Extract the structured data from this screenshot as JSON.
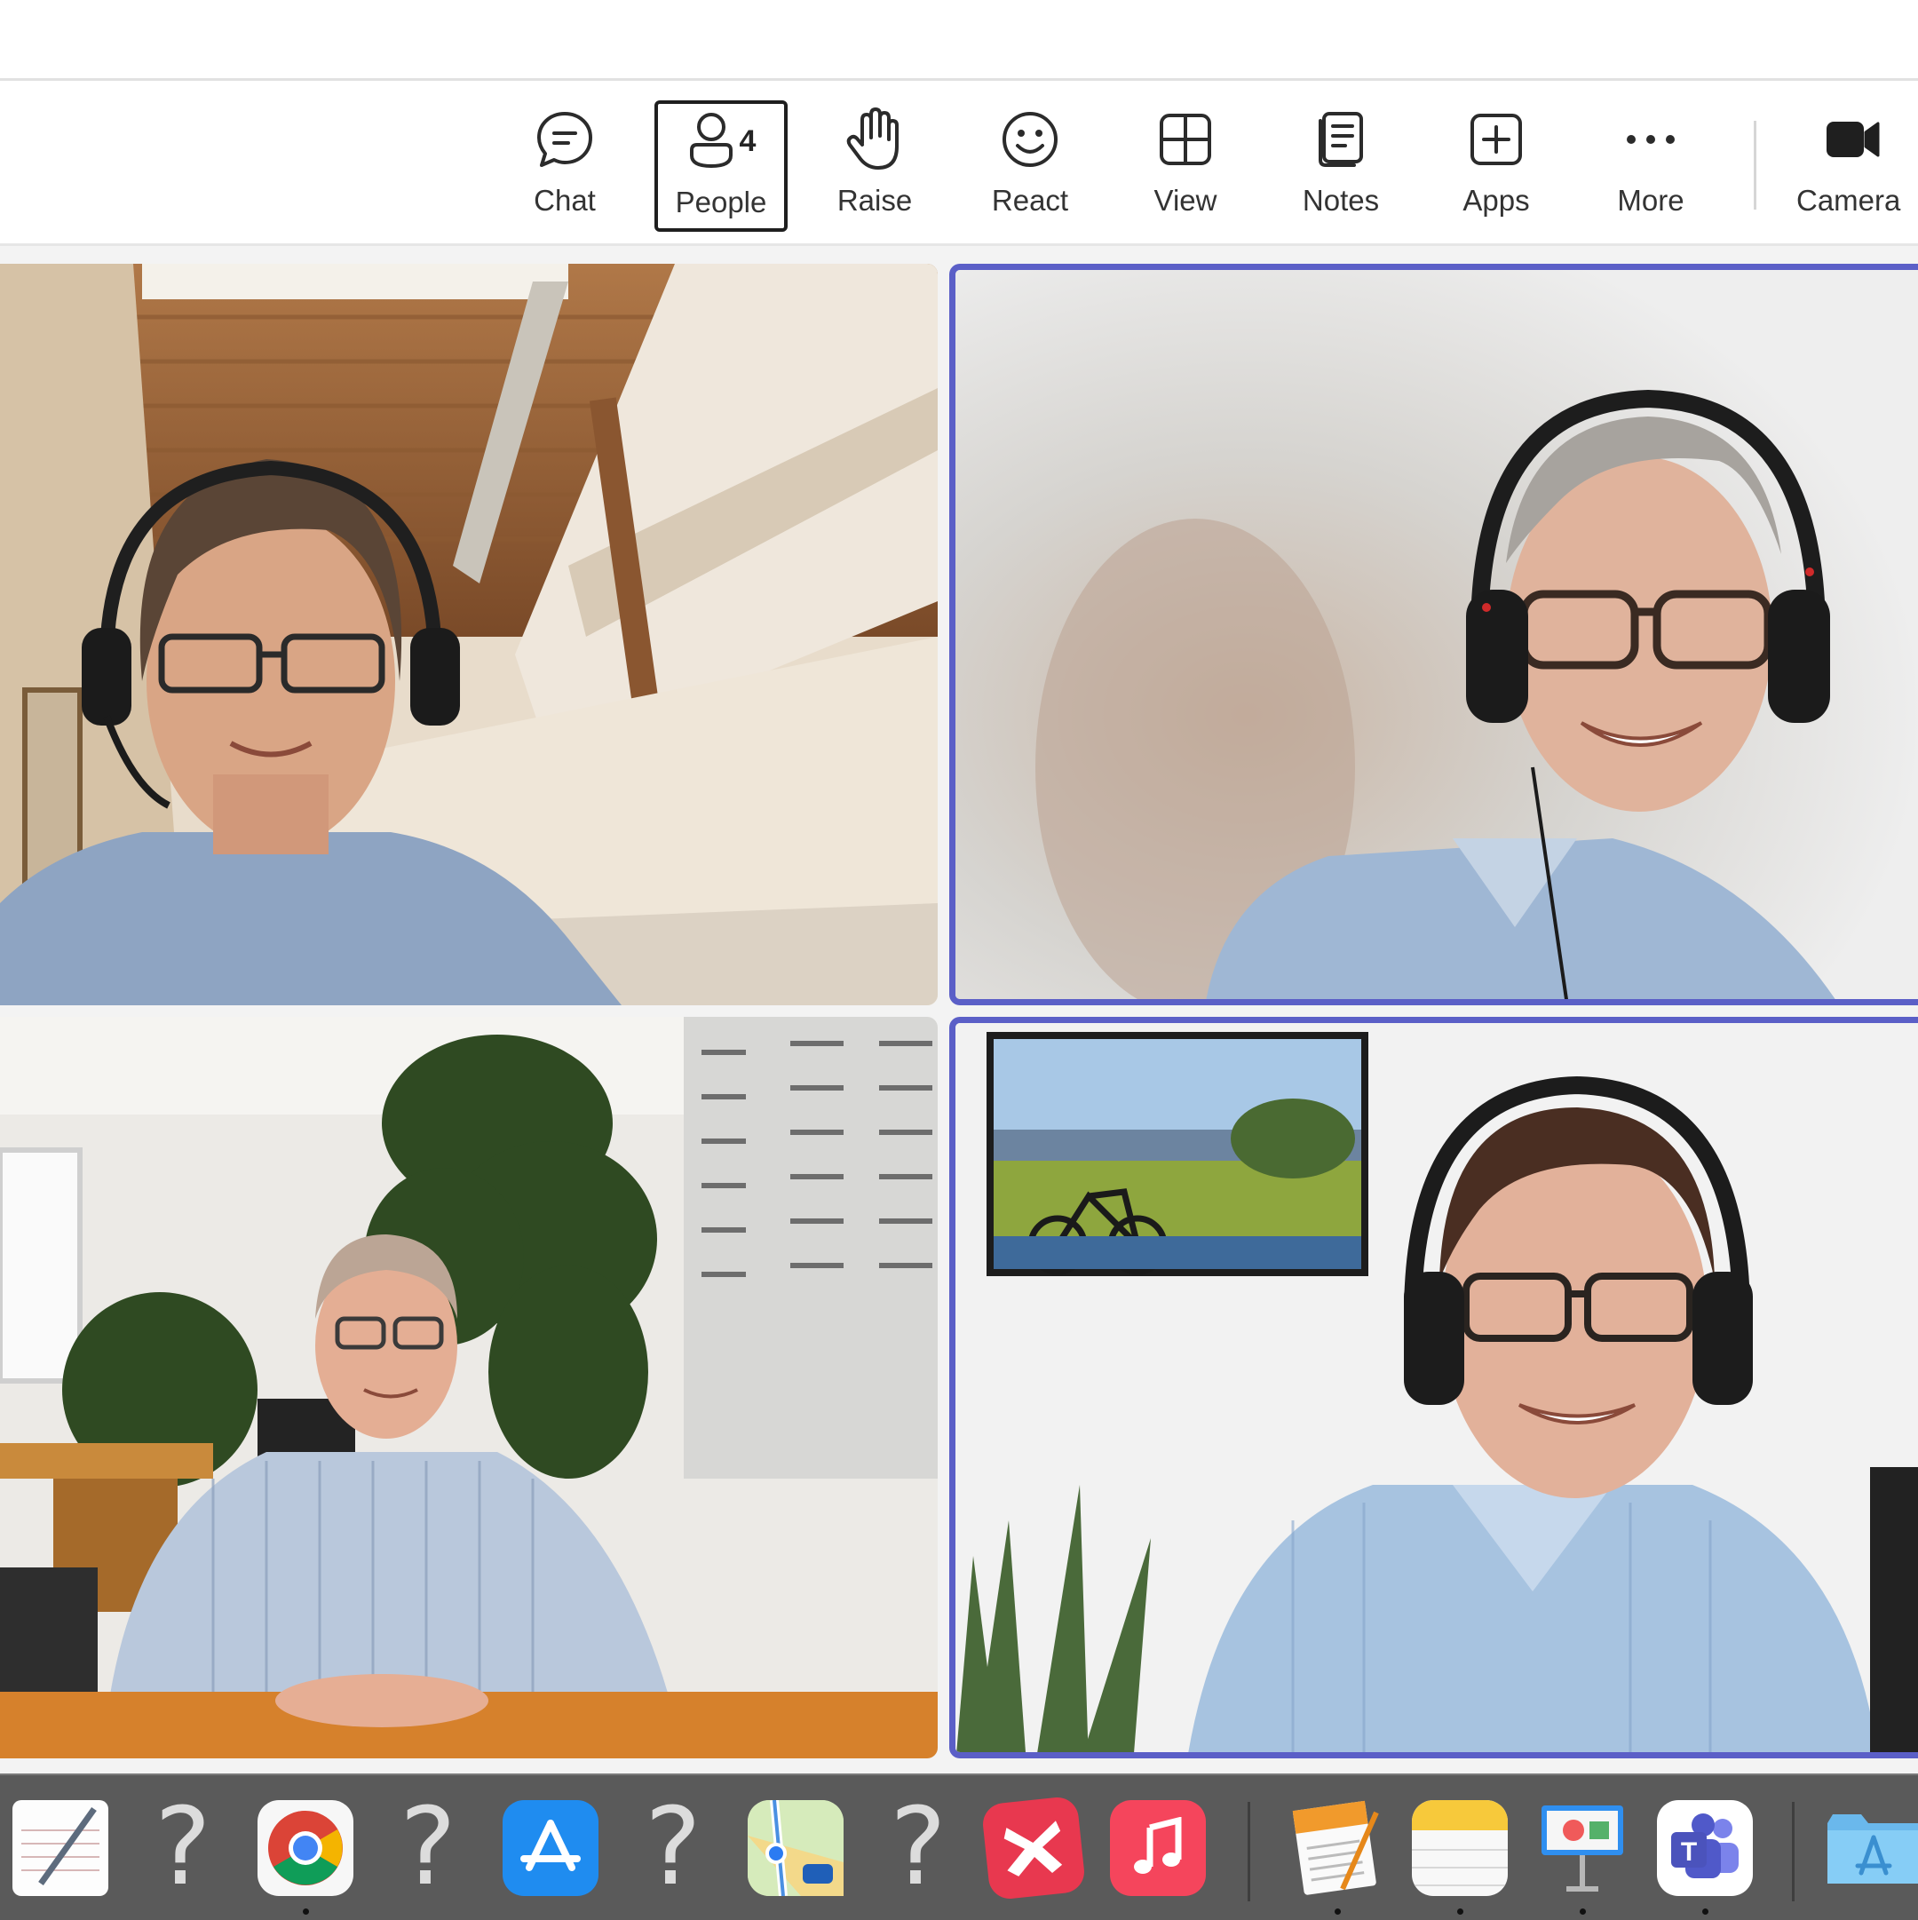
{
  "toolbar": {
    "chat": "Chat",
    "people": "People",
    "people_count": "4",
    "raise": "Raise",
    "react": "React",
    "view": "View",
    "notes": "Notes",
    "apps": "Apps",
    "more": "More",
    "camera": "Camera"
  },
  "colors": {
    "speaking_border": "#5b5fc7",
    "dock_bg": "#5a5a5a"
  },
  "dock": {
    "items": [
      "textedit-icon",
      "unknown-app-icon",
      "chrome-icon",
      "unknown-app-icon",
      "app-store-icon",
      "unknown-app-icon",
      "maps-icon",
      "unknown-app-icon",
      "xmind-icon",
      "music-icon",
      "pages-icon",
      "notes-icon",
      "keynote-icon",
      "teams-icon",
      "folder-icon"
    ],
    "unknown_glyph": "?"
  }
}
